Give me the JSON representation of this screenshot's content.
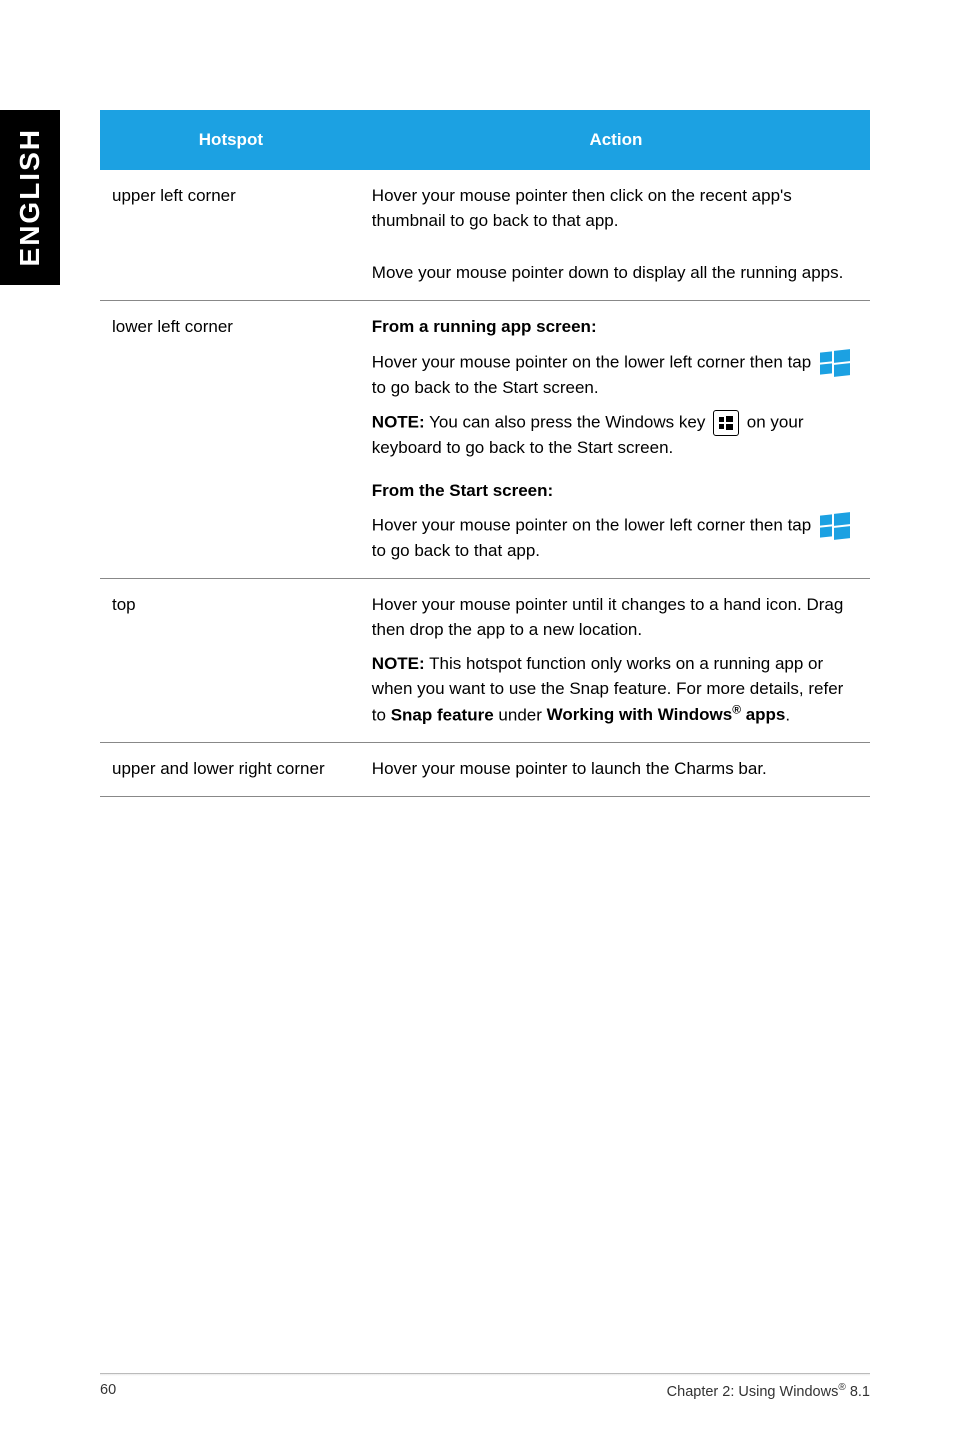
{
  "sidebar": {
    "label": "ENGLISH"
  },
  "table": {
    "headers": {
      "hotspot": "Hotspot",
      "action": "Action"
    },
    "rows": {
      "ulc": {
        "hotspot": "upper left corner",
        "action1": "Hover your mouse pointer then click on the recent app's thumbnail to go back to that app.",
        "action2": "Move your mouse pointer down to display all the running apps."
      },
      "llc": {
        "hotspot": "lower left corner",
        "h1": "From a running app screen:",
        "p1a": "Hover your mouse pointer on the lower left corner then tap ",
        "p1b": " to go back to the Start screen.",
        "note_label": "NOTE:",
        "note_a": "  You can also press the Windows key ",
        "note_b": " on your keyboard to go back to the Start screen.",
        "h2": "From the Start screen:",
        "p2a": "Hover your mouse pointer on the lower left corner then tap ",
        "p2b": " to go back to that app."
      },
      "top": {
        "hotspot": "top",
        "p1": "Hover your mouse pointer until it changes to a hand icon. Drag then drop the app to a new location.",
        "note_label": "NOTE:",
        "note_a": "  This hotspot function only works on a running app or when you want to use the Snap feature. For more details, refer to ",
        "note_b": "Snap feature",
        "note_c": " under ",
        "note_d": "Working with Windows",
        "note_e": " apps",
        "note_f": "."
      },
      "ulr": {
        "hotspot": "upper and lower right corner",
        "action": "Hover your mouse pointer to launch the Charms bar."
      }
    }
  },
  "footer": {
    "page": "60",
    "chapter_a": "Chapter 2: Using Windows",
    "chapter_b": " 8.1"
  }
}
